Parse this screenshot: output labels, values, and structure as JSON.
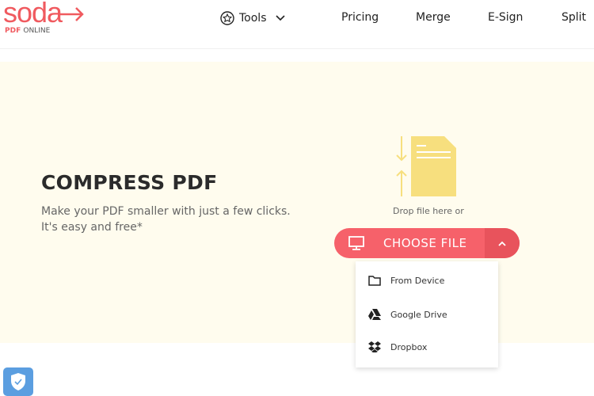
{
  "header": {
    "logo_main": "soda",
    "logo_sub_1": "PDF",
    "logo_sub_2": "ONLINE",
    "nav": [
      {
        "label": "Tools",
        "icon": "star-icon"
      },
      {
        "label": "Pricing"
      },
      {
        "label": "Merge"
      },
      {
        "label": "E-Sign"
      },
      {
        "label": "Split"
      }
    ]
  },
  "hero": {
    "title": "COMPRESS PDF",
    "desc_1": "Make your PDF smaller with just a few clicks.",
    "desc_2": "It's easy and free*"
  },
  "upload": {
    "drop_text": "Drop file here or",
    "button_label": "CHOOSE FILE",
    "menu": [
      {
        "label": "From Device",
        "icon": "folder-icon"
      },
      {
        "label": "Google Drive",
        "icon": "google-drive-icon"
      },
      {
        "label": "Dropbox",
        "icon": "dropbox-icon"
      }
    ]
  },
  "colors": {
    "accent": "#f6616a",
    "banner": "#fffcee",
    "doc": "#f7df7e"
  }
}
